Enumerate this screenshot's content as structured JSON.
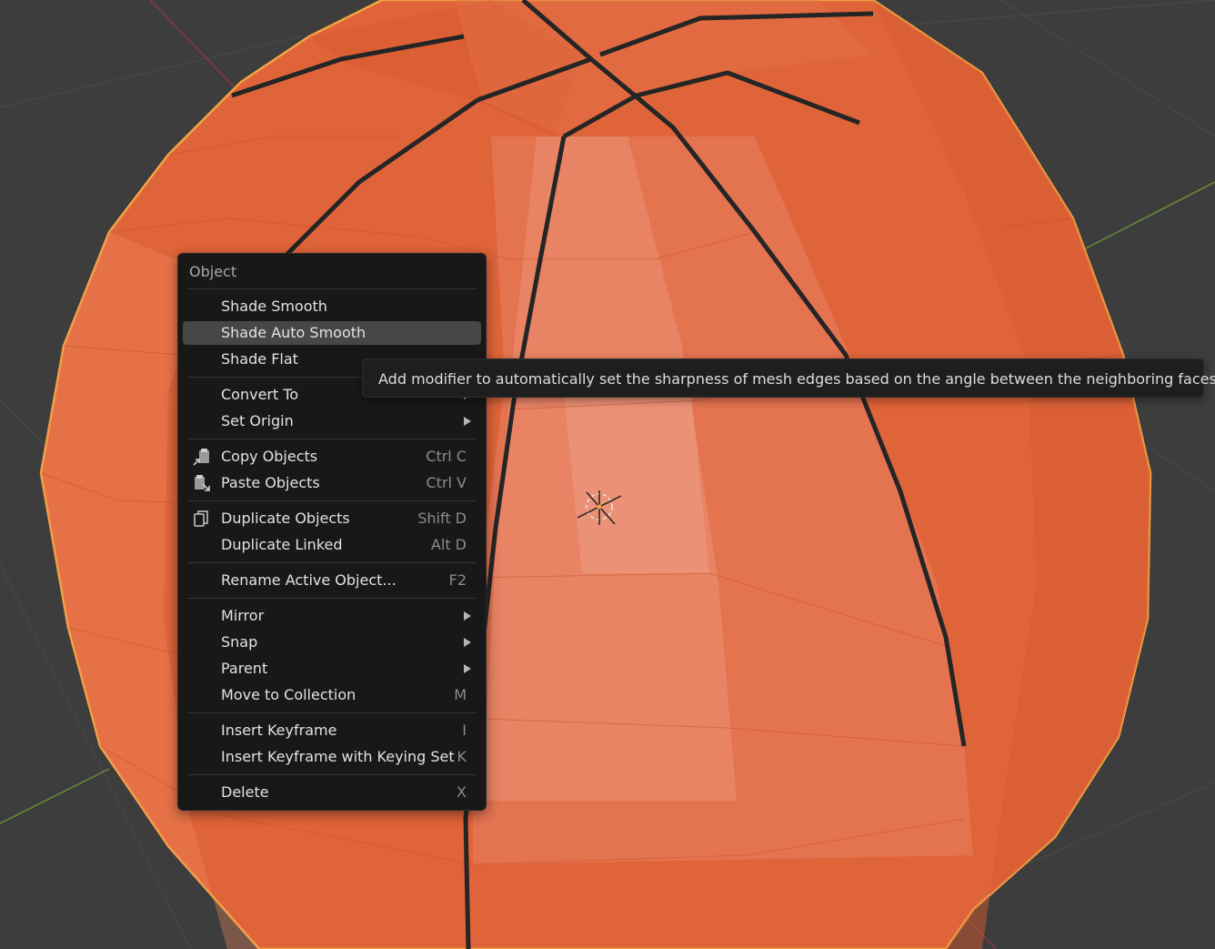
{
  "menu": {
    "title": "Object",
    "items": [
      {
        "label": "Shade Smooth"
      },
      {
        "label": "Shade Auto Smooth"
      },
      {
        "label": "Shade Flat"
      },
      {
        "label": "Convert To"
      },
      {
        "label": "Set Origin"
      },
      {
        "label": "Copy Objects",
        "shortcut": "Ctrl C",
        "icon": "copy-icon"
      },
      {
        "label": "Paste Objects",
        "shortcut": "Ctrl V",
        "icon": "paste-icon"
      },
      {
        "label": "Duplicate Objects",
        "shortcut": "Shift D",
        "icon": "duplicate-icon"
      },
      {
        "label": "Duplicate Linked",
        "shortcut": "Alt D"
      },
      {
        "label": "Rename Active Object...",
        "shortcut": "F2"
      },
      {
        "label": "Mirror"
      },
      {
        "label": "Snap"
      },
      {
        "label": "Parent"
      },
      {
        "label": "Move to Collection",
        "shortcut": "M"
      },
      {
        "label": "Insert Keyframe",
        "shortcut": "I"
      },
      {
        "label": "Insert Keyframe with Keying Set",
        "shortcut": "K"
      },
      {
        "label": "Delete",
        "shortcut": "X"
      }
    ]
  },
  "tooltip": {
    "text": "Add modifier to automatically set the sharpness of mesh edges based on the angle between the neighboring faces."
  },
  "colors": {
    "viewport_bg": "#3d3d3d",
    "object": "#e0643a",
    "selection_outline": "#f2a443",
    "menu_bg": "#181818",
    "menu_highlight": "#474747"
  }
}
